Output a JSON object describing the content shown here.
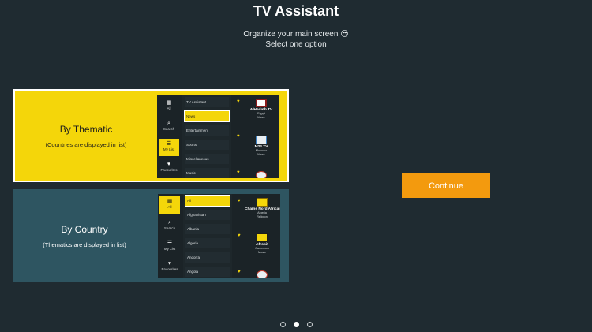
{
  "header": {
    "title": "TV Assistant",
    "subtitle": "Organize your main screen 😎",
    "instruction": "Select one option"
  },
  "options": {
    "thematic": {
      "heading": "By Thematic",
      "description": "(Countries are displayed in list)",
      "preview": {
        "nav": [
          "All",
          "Search",
          "My List",
          "Favourites"
        ],
        "column": [
          "TV Assistant",
          "News",
          "Entertainment",
          "Sports",
          "Miscellaneous",
          "Music"
        ],
        "channels": [
          {
            "name": "AlHadath TV",
            "country": "Egypt",
            "category": "News"
          },
          {
            "name": "M24 TV",
            "country": "Morocco",
            "category": "News"
          }
        ]
      }
    },
    "country": {
      "heading": "By Country",
      "description": "(Thematics are displayed in list)",
      "preview": {
        "nav": [
          "All",
          "Search",
          "My List",
          "Favourites"
        ],
        "column": [
          "All",
          "Afghanistan",
          "Albania",
          "Algeria",
          "Andorra",
          "Angola"
        ],
        "channels": [
          {
            "name": "Chaîne Nord Africaine",
            "country": "Algeria",
            "category": "Religion"
          },
          {
            "name": "Afrobit",
            "country": "Cameroon",
            "category": "Music"
          }
        ]
      }
    }
  },
  "actions": {
    "continue_label": "Continue"
  },
  "pagination": {
    "total": 3,
    "active": 2
  },
  "colors": {
    "background": "#1f2b31",
    "accent_yellow": "#f4d60a",
    "continue_orange": "#f39a0e",
    "country_card": "#2e5561"
  }
}
